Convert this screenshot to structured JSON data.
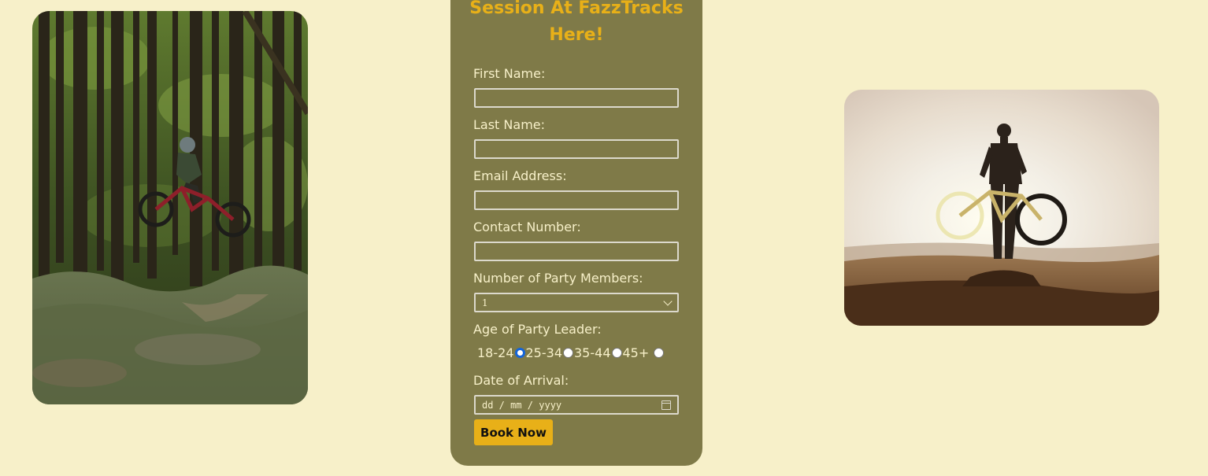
{
  "colors": {
    "page_background": "#f7f0c9",
    "panel_background": "#7f7a48",
    "heading_accent": "#e8b018",
    "button_background": "#e8b018",
    "label_text": "#f7f0c9"
  },
  "images": {
    "left_photo": "mountain-biker-jumping-in-forest",
    "right_photo": "hiker-holding-bike-at-sunset"
  },
  "form": {
    "heading_line1": "Session At FazzTracks",
    "heading_line2": "Here!",
    "first_name_label": "First Name:",
    "first_name_value": "",
    "last_name_label": "Last Name:",
    "last_name_value": "",
    "email_label": "Email Address:",
    "email_value": "",
    "contact_label": "Contact Number:",
    "contact_value": "",
    "party_members_label": "Number of Party Members:",
    "party_members_selected": "1",
    "age_label": "Age of Party Leader:",
    "age_options": [
      "18-24",
      "25-34",
      "35-44",
      "45+"
    ],
    "age_selected_index": 0,
    "arrival_label": "Date of Arrival:",
    "arrival_placeholder": "dd / mm / yyyy",
    "submit_label": "Book Now"
  }
}
